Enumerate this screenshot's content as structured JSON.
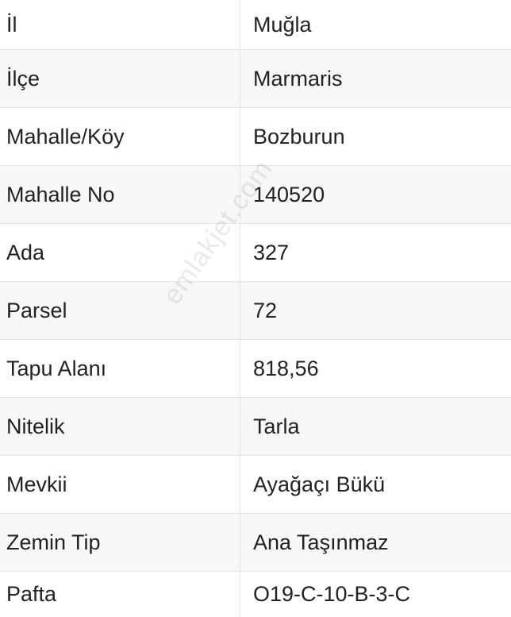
{
  "rows": [
    {
      "label": "İl",
      "value": "Muğla"
    },
    {
      "label": "İlçe",
      "value": "Marmaris"
    },
    {
      "label": "Mahalle/Köy",
      "value": "Bozburun"
    },
    {
      "label": "Mahalle No",
      "value": "140520"
    },
    {
      "label": "Ada",
      "value": "327"
    },
    {
      "label": "Parsel",
      "value": "72"
    },
    {
      "label": "Tapu Alanı",
      "value": "818,56"
    },
    {
      "label": "Nitelik",
      "value": "Tarla"
    },
    {
      "label": "Mevkii",
      "value": "Ayağaçı Bükü"
    },
    {
      "label": "Zemin Tip",
      "value": "Ana Taşınmaz"
    },
    {
      "label": "Pafta",
      "value": "O19-C-10-B-3-C"
    }
  ],
  "watermark": "emlakjet.com"
}
